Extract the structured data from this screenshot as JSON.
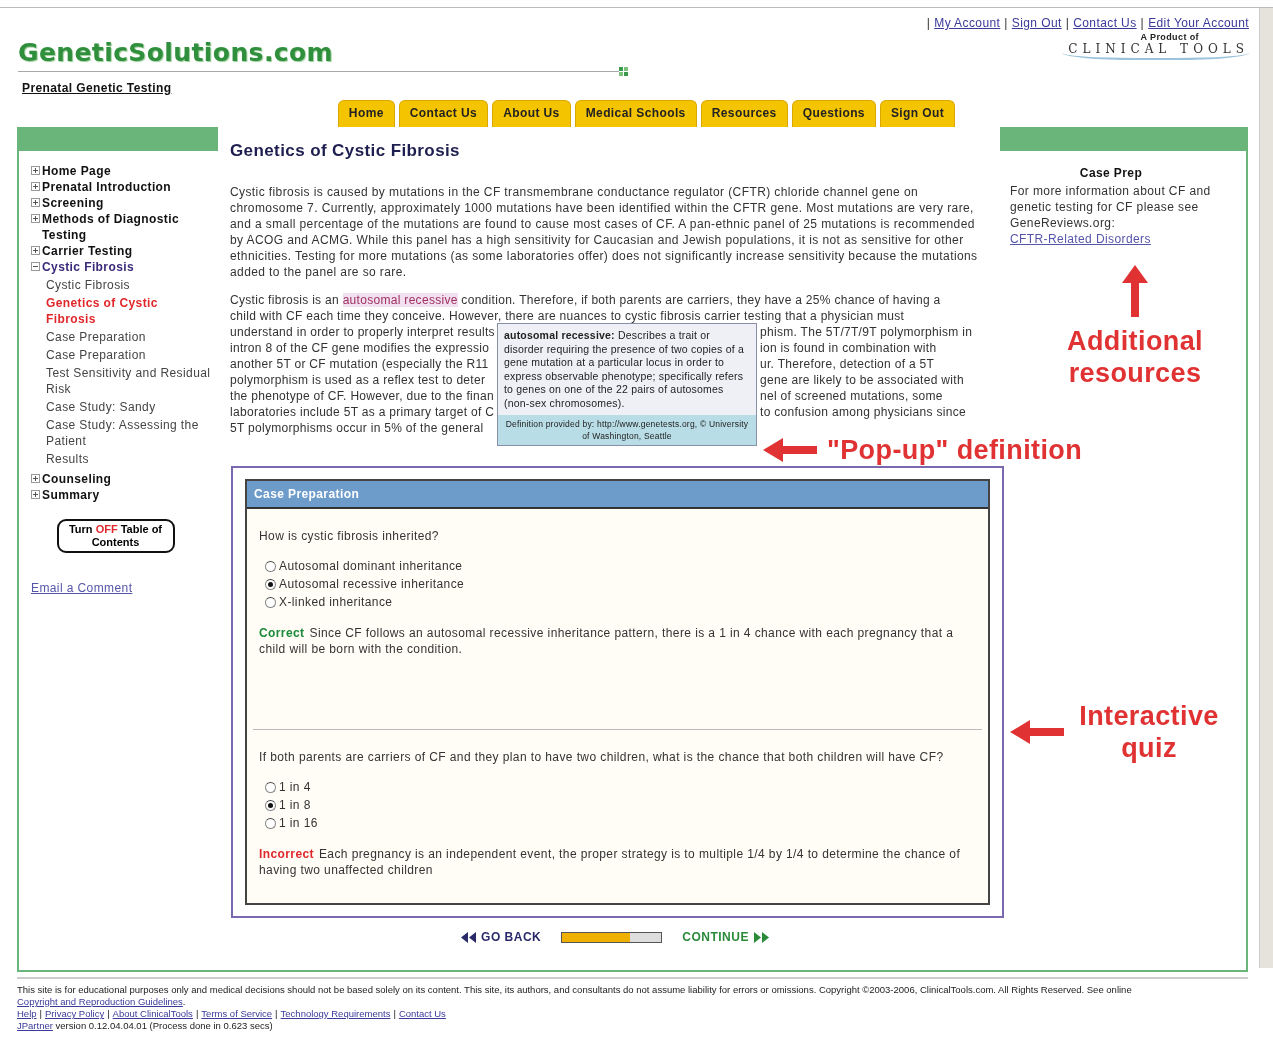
{
  "top_links": [
    "My Account",
    "Sign Out",
    "Contact Us",
    "Edit Your Account"
  ],
  "top_links_separator": "|",
  "site": {
    "logo": "GeneticSolutions.com",
    "subtitle": "Prenatal Genetic Testing"
  },
  "partner": {
    "caption": "A Product of",
    "logo": "CLINICAL TOOLS"
  },
  "nav_tabs": [
    "Home",
    "Contact Us",
    "About Us",
    "Medical Schools",
    "Resources",
    "Questions",
    "Sign Out"
  ],
  "sidebar": {
    "items": [
      {
        "label": "Home Page",
        "expanded": false
      },
      {
        "label": "Prenatal Introduction",
        "expanded": false
      },
      {
        "label": "Screening",
        "expanded": false
      },
      {
        "label": "Methods of Diagnostic Testing",
        "expanded": false
      },
      {
        "label": "Carrier Testing",
        "expanded": false
      },
      {
        "label": "Cystic Fibrosis",
        "expanded": true,
        "children": [
          {
            "label": "Cystic Fibrosis",
            "selected": false
          },
          {
            "label": "Genetics of Cystic Fibrosis",
            "selected": true
          },
          {
            "label": "Case Preparation",
            "selected": false
          },
          {
            "label": "Case Preparation",
            "selected": false
          },
          {
            "label": "Test Sensitivity and Residual Risk",
            "selected": false
          },
          {
            "label": "Case Study: Sandy",
            "selected": false
          },
          {
            "label": "Case Study: Assessing the Patient",
            "selected": false
          },
          {
            "label": "Results",
            "selected": false
          }
        ]
      },
      {
        "label": "Counseling",
        "expanded": false
      },
      {
        "label": "Summary",
        "expanded": false
      }
    ],
    "toc_button": {
      "before": "Turn ",
      "emphasis": "OFF",
      "after": " Table of Contents"
    },
    "email_link": "Email a Comment"
  },
  "article": {
    "title": "Genetics of Cystic Fibrosis",
    "paragraph_1": "Cystic fibrosis is caused by mutations in the CF transmembrane conductance regulator (CFTR) chloride channel gene on chromosome 7. Currently, approximately 1000 mutations have been identified within the CFTR gene. Most mutations are very rare, and a small percentage of the mutations are found to cause most cases of CF. A pan-ethnic panel of 25 mutations is recommended by ACOG and ACMG. While this panel has a high sensitivity for Caucasian and Jewish populations, it is not as sensitive for other ethnicities. Testing for more mutations (as some laboratories offer) does not significantly increase sensitivity because the mutations added to the panel are so rare.",
    "paragraph_2": {
      "first_line": {
        "before": "Cystic fibrosis is an ",
        "term": "autosomal recessive",
        "after": " condition. Therefore, if both parents are carriers, they have a 25% chance of having a"
      },
      "lines": [
        {
          "left": "child with CF each time they conceive. However, there are nuances to cystic fibrosis carrier testing that a physician must"
        },
        {
          "left": "understand in order to properly interpret results",
          "right": "phism. The 5T/7T/9T polymorphism in"
        },
        {
          "left": "intron 8 of the CF gene modifies the expressio",
          "right": "ion is found in combination with"
        },
        {
          "left": "another 5T or CF mutation (especially the R11",
          "right": "ur. Therefore, detection of a 5T"
        },
        {
          "left": "polymorphism is used as a reflex test to deter",
          "right": "gene are likely to be associated with"
        },
        {
          "left": "the phenotype of CF. However, due to the finan",
          "right": "nel of screened mutations, some"
        },
        {
          "left": "laboratories include 5T as a primary target of C",
          "right": "to confusion among physicians since"
        },
        {
          "left": "5T polymorphisms occur in 5% of the general"
        }
      ]
    },
    "popup": {
      "definition": "**autosomal recessive:** Describes a trait or disorder requiring the presence of two copies of a gene mutation at a particular locus in order to express observable phenotype; specifically refers to genes on one of the 22 pairs of autosomes (non-sex chromosomes).",
      "source": "Definition provided by: http://www.genetests.org, © University of Washington, Seattle"
    }
  },
  "quiz": {
    "title": "Case Preparation",
    "questions": [
      {
        "question": "How is cystic fibrosis inherited?",
        "options": [
          {
            "label": "Autosomal dominant inheritance",
            "selected": false
          },
          {
            "label": "Autosomal recessive inheritance",
            "selected": true
          },
          {
            "label": "X-linked inheritance",
            "selected": false
          }
        ],
        "feedback": {
          "kind": "correct",
          "label": "Correct",
          "text": "Since CF follows an autosomal recessive inheritance pattern, there is a 1 in 4 chance with each pregnancy that a child will be born with the condition."
        }
      },
      {
        "question": "If both parents are carriers of CF and they plan to have two children, what is the chance that both children will have CF?",
        "options": [
          {
            "label": "1 in 4",
            "selected": false
          },
          {
            "label": "1 in 8",
            "selected": true
          },
          {
            "label": "1 in 16",
            "selected": false
          }
        ],
        "feedback": {
          "kind": "incorrect",
          "label": "Incorrect",
          "text": "Each pregnancy is an independent event, the proper strategy is to multiple 1/4 by 1/4 to determine the chance of having two unaffected children"
        }
      }
    ]
  },
  "pager": {
    "back": "GO BACK",
    "level": 0.68,
    "continue": "CONTINUE"
  },
  "side_panel": {
    "title": "Case Prep",
    "text": "For more information about CF and genetic testing for CF please see GeneReviews.org: ",
    "link": "CFTR-Related Disorders"
  },
  "annotations": [
    {
      "kind": "up",
      "text": "Additional resources"
    },
    {
      "kind": "left",
      "text": "\"Pop-up\" definition"
    },
    {
      "kind": "left",
      "text": "Interactive quiz"
    }
  ],
  "footer": {
    "disclaimer": "This site is for educational purposes only and medical decisions should not be based solely on its content. This site, its authors, and consultants do not assume liability for errors or omissions. Copyright ©2003-2006, ClinicalTools.com. All Rights Reserved. See online ",
    "disclaimer_link": "Copyright and Reproduction Guidelines",
    "disclaimer_end": ".",
    "links_separator": "|",
    "links": [
      "Help",
      "Privacy Policy",
      "About ClinicalTools",
      "Terms of Service",
      "Technology Requirements",
      "Contact Us"
    ],
    "version_link": "JPartner",
    "version": " version 0.12.04.04.01 (Process done in 0.623 secs)"
  }
}
